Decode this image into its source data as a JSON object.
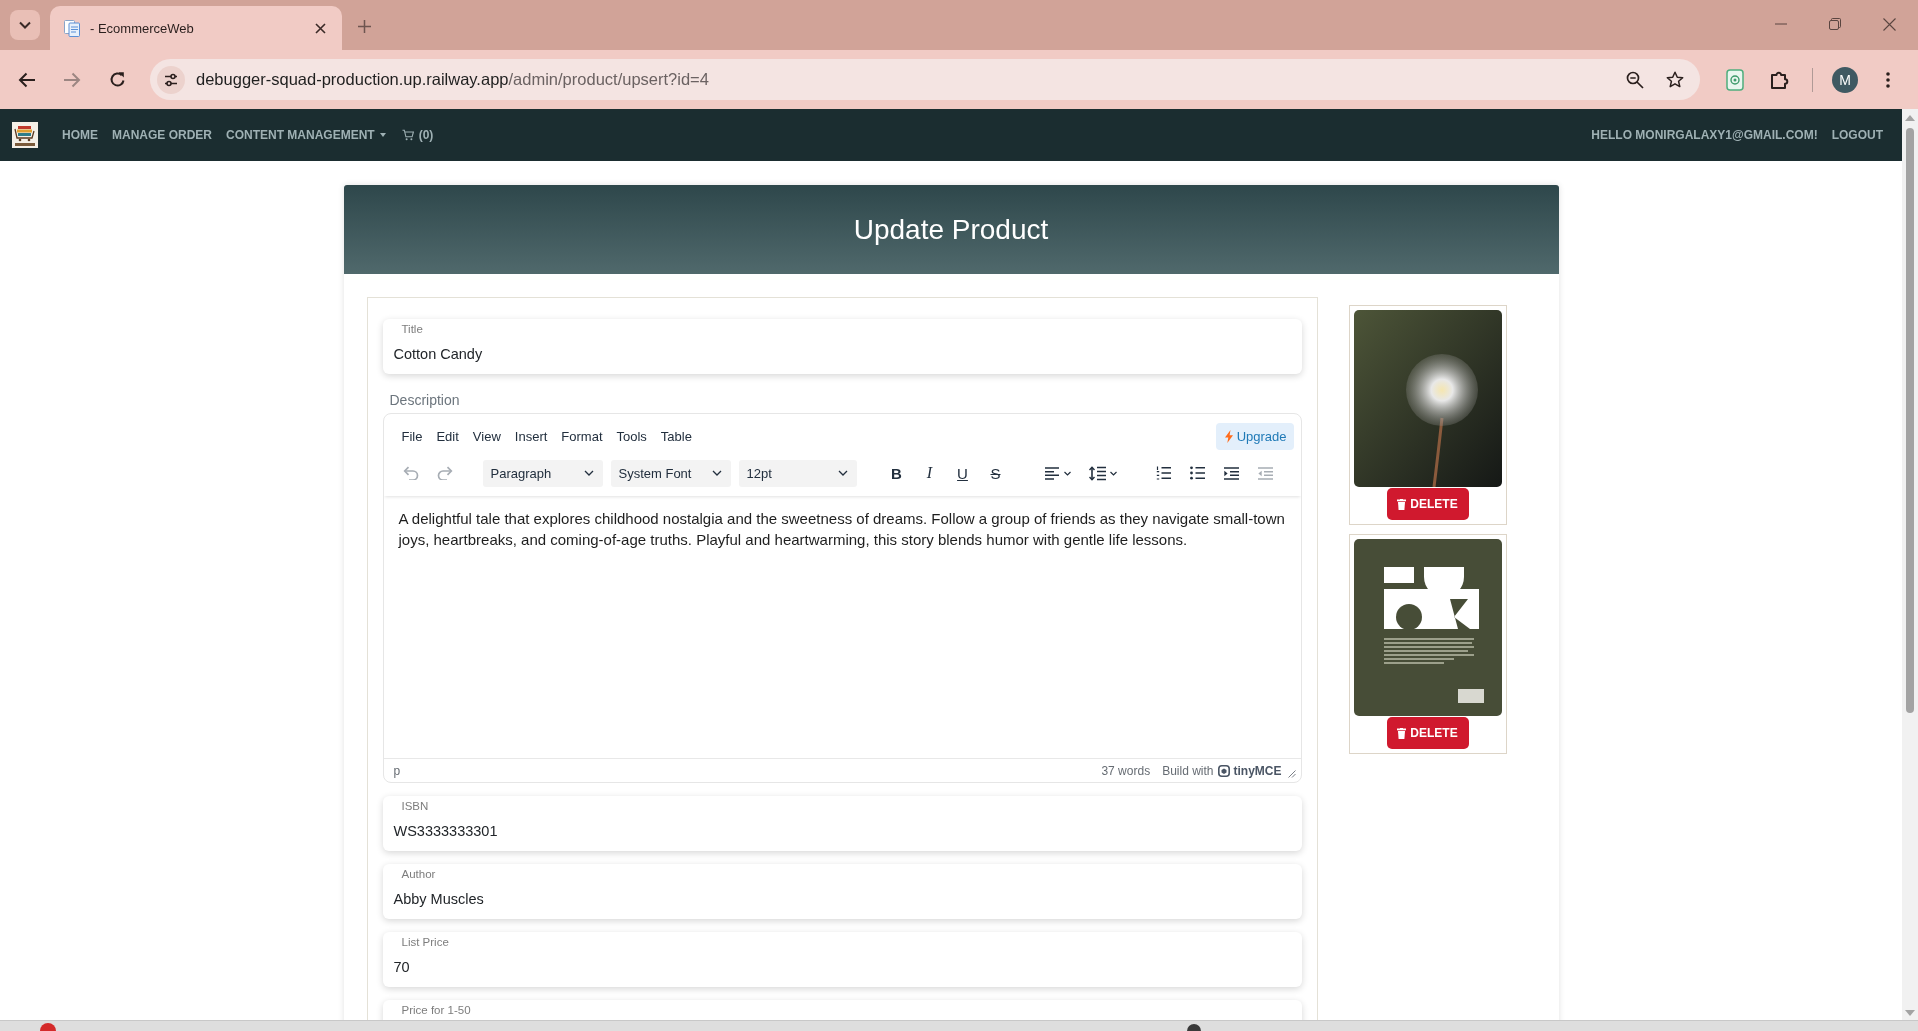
{
  "browser": {
    "tab": {
      "title": "- EcommerceWeb"
    },
    "nav_buttons": [
      {
        "kind": "back",
        "disabled": false
      },
      {
        "kind": "forward",
        "disabled": true
      },
      {
        "kind": "reload",
        "disabled": false
      }
    ],
    "address": {
      "host": "debugger-squad-production.up.railway.app",
      "path": "/admin/product/upsert?id=4"
    },
    "profile": {
      "initial": "M"
    }
  },
  "navbar": {
    "links": [
      {
        "kind": "link",
        "label": "HOME"
      },
      {
        "kind": "link",
        "label": "MANAGE ORDER"
      },
      {
        "kind": "dropdown",
        "label": "CONTENT MANAGEMENT"
      },
      {
        "kind": "cart",
        "label": "(0)"
      }
    ],
    "greeting": "HELLO MONIRGALAXY1@GMAIL.COM!",
    "logout": "LOGOUT"
  },
  "page": {
    "heading": "Update Product"
  },
  "form": {
    "title_field": {
      "label": "Title",
      "value": "Cotton Candy"
    },
    "description": {
      "label": "Description",
      "menu": [
        "File",
        "Edit",
        "View",
        "Insert",
        "Format",
        "Tools",
        "Table"
      ],
      "upgrade": "Upgrade",
      "history": [
        {
          "kind": "undo",
          "disabled": true
        },
        {
          "kind": "redo",
          "disabled": true
        }
      ],
      "selects": [
        {
          "value": "Paragraph"
        },
        {
          "value": "System Font"
        },
        {
          "value": "12pt"
        }
      ],
      "formats": [
        {
          "kind": "bold",
          "label": "B"
        },
        {
          "kind": "italic",
          "label": "I"
        },
        {
          "kind": "underline",
          "label": "U"
        },
        {
          "kind": "strikethrough",
          "label": "S"
        }
      ],
      "tools": [
        {
          "kind": "align",
          "disabled": false
        },
        {
          "kind": "line-height",
          "disabled": false
        },
        {
          "kind": "numbered-list",
          "disabled": false
        },
        {
          "kind": "bullet-list",
          "disabled": false
        },
        {
          "kind": "indent",
          "disabled": false
        },
        {
          "kind": "outdent",
          "disabled": true
        }
      ],
      "content": "A delightful tale that explores childhood nostalgia and the sweetness of dreams. Follow a group of friends as they navigate small-town joys, heartbreaks, and coming-of-age truths. Playful and heartwarming, this story blends humor with gentle life lessons.",
      "element_path": "p",
      "word_count": "37 words",
      "branding": {
        "prefix": "Build with",
        "brand": "tinyMCE"
      }
    },
    "fields": [
      {
        "label": "ISBN",
        "value": "WS3333333301"
      },
      {
        "label": "Author",
        "value": "Abby Muscles"
      },
      {
        "label": "List Price",
        "value": "70"
      },
      {
        "label": "Price for 1-50"
      }
    ]
  },
  "images": [
    {
      "kind": "dandelion",
      "delete_label": "DELETE"
    },
    {
      "kind": "pattern",
      "delete_label": "DELETE"
    }
  ]
}
